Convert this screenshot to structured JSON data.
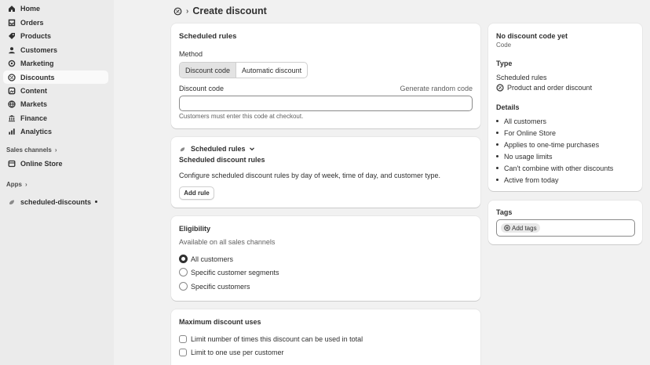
{
  "sidebar": {
    "items": [
      {
        "label": "Home",
        "icon": "home-icon"
      },
      {
        "label": "Orders",
        "icon": "orders-icon"
      },
      {
        "label": "Products",
        "icon": "products-icon"
      },
      {
        "label": "Customers",
        "icon": "customers-icon"
      },
      {
        "label": "Marketing",
        "icon": "marketing-icon"
      },
      {
        "label": "Discounts",
        "icon": "discounts-icon",
        "active": true
      },
      {
        "label": "Content",
        "icon": "content-icon"
      },
      {
        "label": "Markets",
        "icon": "markets-icon"
      },
      {
        "label": "Finance",
        "icon": "finance-icon"
      },
      {
        "label": "Analytics",
        "icon": "analytics-icon"
      }
    ],
    "sales_channels_label": "Sales channels",
    "online_store_label": "Online Store",
    "apps_label": "Apps",
    "app_item_label": "scheduled-discounts"
  },
  "header": {
    "title": "Create discount"
  },
  "scheduled_rules_card": {
    "title": "Scheduled rules",
    "method_label": "Method",
    "method_options": [
      "Discount code",
      "Automatic discount"
    ],
    "discount_code_label": "Discount code",
    "generate_link": "Generate random code",
    "code_value": "",
    "helper_text": "Customers must enter this code at checkout."
  },
  "app_block": {
    "dropdown_label": "Scheduled rules",
    "title": "Scheduled discount rules",
    "description": "Configure scheduled discount rules by day of week, time of day, and customer type.",
    "add_rule_label": "Add rule"
  },
  "eligibility": {
    "title": "Eligibility",
    "subtitle": "Available on all sales channels",
    "options": [
      "All customers",
      "Specific customer segments",
      "Specific customers"
    ],
    "selected": "All customers"
  },
  "max_uses": {
    "title": "Maximum discount uses",
    "options": [
      "Limit number of times this discount can be used in total",
      "Limit to one use per customer"
    ]
  },
  "summary": {
    "code_title": "No discount code yet",
    "code_sub": "Code",
    "type_title": "Type",
    "type_name": "Scheduled rules",
    "type_detail": "Product and order discount",
    "details_title": "Details",
    "details": [
      "All customers",
      "For Online Store",
      "Applies to one-time purchases",
      "No usage limits",
      "Can't combine with other discounts",
      "Active from today"
    ]
  },
  "tags": {
    "title": "Tags",
    "add_label": "Add tags"
  }
}
